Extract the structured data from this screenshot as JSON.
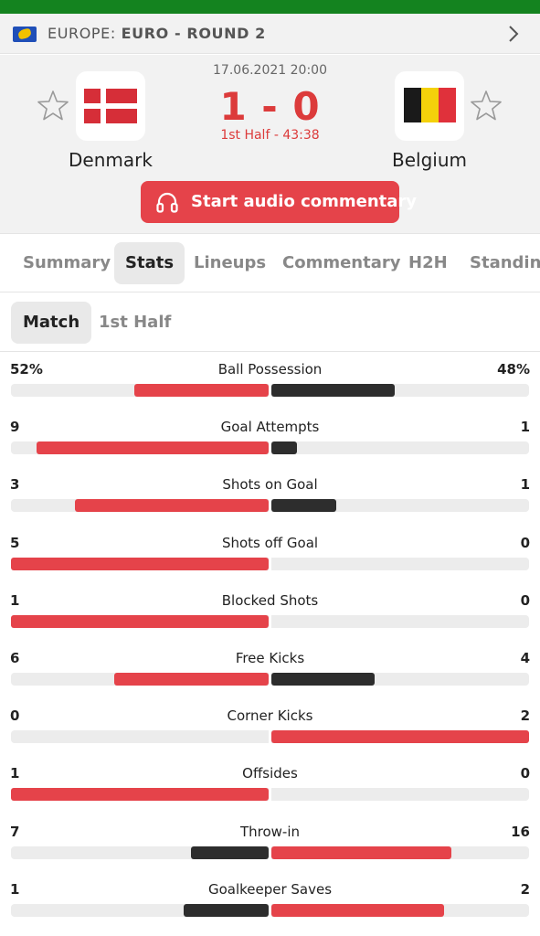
{
  "league": {
    "region": "EUROPE:",
    "name": "EURO - ROUND 2"
  },
  "match": {
    "date": "17.06.2021 20:00",
    "score": "1 - 0",
    "status": "1st Half - 43:38",
    "home": {
      "name": "Denmark"
    },
    "away": {
      "name": "Belgium"
    },
    "audio_button": "Start audio commentary"
  },
  "tabs": [
    "Summary",
    "Stats",
    "Lineups",
    "Commentary",
    "H2H",
    "Standings"
  ],
  "active_tab": "Stats",
  "subtabs": [
    "Match",
    "1st Half"
  ],
  "active_subtab": "Match",
  "colors": {
    "red": "#e5434a",
    "dark": "#2d2d2d",
    "track": "#ececec",
    "green": "#14831f"
  },
  "stats": [
    {
      "name": "Ball Possession",
      "home": "52%",
      "away": "48%",
      "home_share": 0.52,
      "away_share": 0.48,
      "leader": "home"
    },
    {
      "name": "Goal Attempts",
      "home": "9",
      "away": "1",
      "home_share": 0.9,
      "away_share": 0.1,
      "leader": "home"
    },
    {
      "name": "Shots on Goal",
      "home": "3",
      "away": "1",
      "home_share": 0.75,
      "away_share": 0.25,
      "leader": "home"
    },
    {
      "name": "Shots off Goal",
      "home": "5",
      "away": "0",
      "home_share": 1.0,
      "away_share": 0.0,
      "leader": "home"
    },
    {
      "name": "Blocked Shots",
      "home": "1",
      "away": "0",
      "home_share": 1.0,
      "away_share": 0.0,
      "leader": "home"
    },
    {
      "name": "Free Kicks",
      "home": "6",
      "away": "4",
      "home_share": 0.6,
      "away_share": 0.4,
      "leader": "home"
    },
    {
      "name": "Corner Kicks",
      "home": "0",
      "away": "2",
      "home_share": 0.0,
      "away_share": 1.0,
      "leader": "away"
    },
    {
      "name": "Offsides",
      "home": "1",
      "away": "0",
      "home_share": 1.0,
      "away_share": 0.0,
      "leader": "home"
    },
    {
      "name": "Throw-in",
      "home": "7",
      "away": "16",
      "home_share": 0.3,
      "away_share": 0.7,
      "leader": "away"
    },
    {
      "name": "Goalkeeper Saves",
      "home": "1",
      "away": "2",
      "home_share": 0.33,
      "away_share": 0.67,
      "leader": "away"
    }
  ]
}
